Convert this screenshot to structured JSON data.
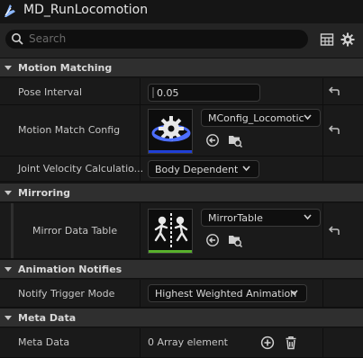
{
  "window": {
    "title": "MD_RunLocomotion"
  },
  "search": {
    "placeholder": "Search"
  },
  "toolbar": {
    "table_icon": "table-view-icon",
    "settings_icon": "gear-icon"
  },
  "sections": {
    "motion_matching": "Motion Matching",
    "mirroring": "Mirroring",
    "animation_notifies": "Animation Notifies",
    "meta_data": "Meta Data"
  },
  "properties": {
    "pose_interval": {
      "label": "Pose Interval",
      "value": "0.05"
    },
    "motion_match_config": {
      "label": "Motion Match Config",
      "value": "MConfig_Locomotic",
      "thumb_color": "#1f3fd6"
    },
    "joint_velocity": {
      "label": "Joint Velocity Calculatio...",
      "value": "Body Dependent"
    },
    "mirror_data_table": {
      "label": "Mirror Data Table",
      "value": "MirrorTable",
      "thumb_color": "#58b02c"
    },
    "notify_trigger_mode": {
      "label": "Notify Trigger Mode",
      "value": "Highest Weighted Animation"
    },
    "meta_data": {
      "label": "Meta Data",
      "value": "0 Array element"
    }
  },
  "colors": {
    "accent_blue": "#1f3fd6",
    "accent_green": "#58b02c",
    "panel_bg": "#1a1a1a",
    "section_bg": "#2f2f2f"
  }
}
